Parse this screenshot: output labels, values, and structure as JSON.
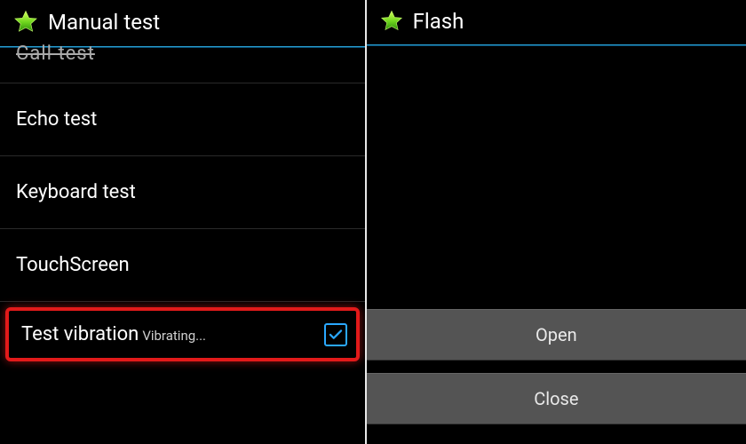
{
  "left": {
    "title": "Manual test",
    "items": [
      {
        "label": "Call test",
        "strike": true
      },
      {
        "label": "Echo test"
      },
      {
        "label": "Keyboard test"
      },
      {
        "label": "TouchScreen"
      }
    ],
    "highlighted": {
      "label": "Test vibration",
      "sublabel": "Vibrating...",
      "checked": true
    }
  },
  "right": {
    "title": "Flash",
    "buttons": {
      "open": "Open",
      "close": "Close"
    }
  }
}
